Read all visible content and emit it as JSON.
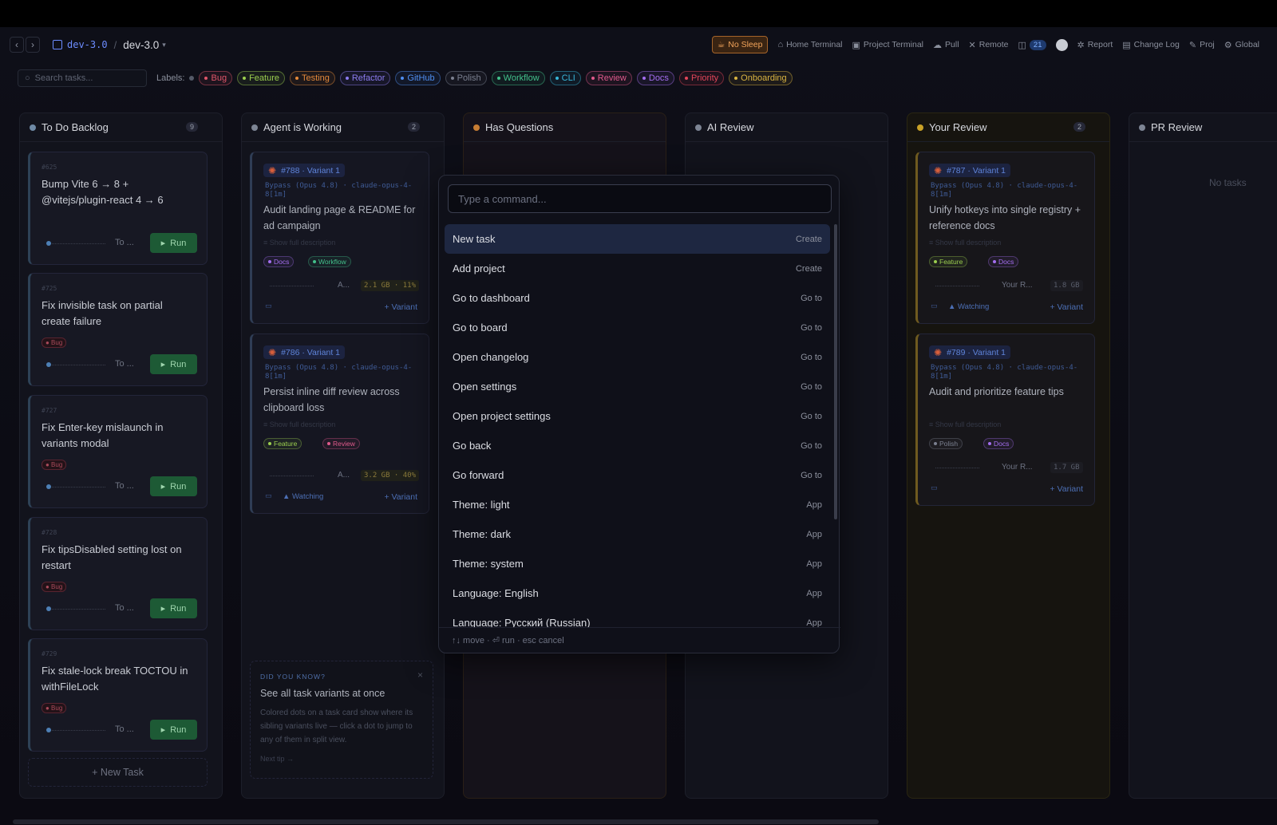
{
  "topbar": {
    "crumb_repo": "dev-3.0",
    "crumb_project": "dev-3.0",
    "no_sleep": "No Sleep",
    "home_terminal": "Home Terminal",
    "project_terminal": "Project Terminal",
    "pull": "Pull",
    "remote": "Remote",
    "count_badge": "21",
    "report": "Report",
    "change_log": "Change Log",
    "proj": "Proj",
    "global": "Global"
  },
  "labelbar": {
    "search_placeholder": "Search tasks...",
    "labels_title": "Labels:",
    "labels": [
      {
        "name": "Bug",
        "color": "#e0566a"
      },
      {
        "name": "Feature",
        "color": "#9bcf4f"
      },
      {
        "name": "Testing",
        "color": "#e4893a"
      },
      {
        "name": "Refactor",
        "color": "#8c7cf0"
      },
      {
        "name": "GitHub",
        "color": "#4f8ef0"
      },
      {
        "name": "Polish",
        "color": "#7b8090"
      },
      {
        "name": "Workflow",
        "color": "#42c08a"
      },
      {
        "name": "CLI",
        "color": "#38b6d8"
      },
      {
        "name": "Review",
        "color": "#e05a8c"
      },
      {
        "name": "Docs",
        "color": "#a46ef0"
      },
      {
        "name": "Priority",
        "color": "#e2465a"
      },
      {
        "name": "Onboarding",
        "color": "#d9b441"
      }
    ]
  },
  "columns": [
    {
      "title": "To Do Backlog",
      "count": "9",
      "color": "#6f8aa6"
    },
    {
      "title": "Agent is Working",
      "count": "2",
      "color": "#7d8594"
    },
    {
      "title": "Has Questions",
      "count": "",
      "color": "#c77d33"
    },
    {
      "title": "AI Review",
      "count": "",
      "color": "#7d8594"
    },
    {
      "title": "Your Review",
      "count": "2",
      "color": "#c9a227"
    },
    {
      "title": "PR Review",
      "count": "",
      "color": "#7d8594"
    }
  ],
  "backlog": {
    "cards": [
      {
        "num": "#625",
        "title": "Bump Vite 6 → 8 + @vitejs/plugin-react 4 → 6",
        "tag": "",
        "status": "To ...",
        "run": "Run"
      },
      {
        "num": "#725",
        "title": "Fix invisible task on partial create failure",
        "tag": "Bug",
        "status": "To ...",
        "run": "Run"
      },
      {
        "num": "#727",
        "title": "Fix Enter-key mislaunch in variants modal",
        "tag": "Bug",
        "status": "To ...",
        "run": "Run"
      },
      {
        "num": "#728",
        "title": "Fix tipsDisabled setting lost on restart",
        "tag": "Bug",
        "status": "To ...",
        "run": "Run"
      },
      {
        "num": "#729",
        "title": "Fix stale-lock break TOCTOU in withFileLock",
        "tag": "Bug",
        "status": "To ...",
        "run": "Run"
      }
    ],
    "new_task": "+ New Task"
  },
  "agent_cards": [
    {
      "id": "#788 · Variant 1",
      "bypass": "Bypass (Opus 4.8) · claude-opus-4-8[1m]",
      "title": "Audit landing page & README for ad campaign",
      "show": "Show full description",
      "tags": [
        "Docs",
        "Workflow"
      ],
      "status": "A...",
      "mem": "2.1 GB · 11%",
      "watch": "",
      "variant": "+ Variant"
    },
    {
      "id": "#786 · Variant 1",
      "bypass": "Bypass (Opus 4.8) · claude-opus-4-8[1m]",
      "title": "Persist inline diff review across clipboard loss",
      "show": "Show full description",
      "tags": [
        "Feature",
        "Review"
      ],
      "status": "A...",
      "mem": "3.2 GB · 40%",
      "watch": "Watching",
      "variant": "+ Variant"
    }
  ],
  "review_cards": [
    {
      "id": "#787 · Variant 1",
      "bypass": "Bypass (Opus 4.8) · claude-opus-4-8[1m]",
      "title": "Unify hotkeys into single registry + reference docs",
      "show": "Show full description",
      "tags": [
        "Feature",
        "Docs"
      ],
      "status": "Your R...",
      "mem": "1.8 GB",
      "watch": "Watching",
      "variant": "+ Variant"
    },
    {
      "id": "#789 · Variant 1",
      "bypass": "Bypass (Opus 4.8) · claude-opus-4-8[1m]",
      "title": "Audit and prioritize feature tips",
      "show": "Show full description",
      "tags": [
        "Polish",
        "Docs"
      ],
      "status": "Your R...",
      "mem": "1.7 GB",
      "watch": "",
      "variant": "+ Variant"
    }
  ],
  "tip": {
    "label": "DID YOU KNOW?",
    "heading": "See all task variants at once",
    "body": "Colored dots on a task card show where its sibling variants live — click a dot to jump to any of them in split view.",
    "next": "Next tip →"
  },
  "pr_review": {
    "empty": "No tasks"
  },
  "palette": {
    "placeholder": "Type a command...",
    "items": [
      {
        "label": "New task",
        "kind": "Create"
      },
      {
        "label": "Add project",
        "kind": "Create"
      },
      {
        "label": "Go to dashboard",
        "kind": "Go to"
      },
      {
        "label": "Go to board",
        "kind": "Go to"
      },
      {
        "label": "Open changelog",
        "kind": "Go to"
      },
      {
        "label": "Open settings",
        "kind": "Go to"
      },
      {
        "label": "Open project settings",
        "kind": "Go to"
      },
      {
        "label": "Go back",
        "kind": "Go to"
      },
      {
        "label": "Go forward",
        "kind": "Go to"
      },
      {
        "label": "Theme: light",
        "kind": "App"
      },
      {
        "label": "Theme: dark",
        "kind": "App"
      },
      {
        "label": "Theme: system",
        "kind": "App"
      },
      {
        "label": "Language: English",
        "kind": "App"
      },
      {
        "label": "Language: Русский (Russian)",
        "kind": "App"
      }
    ],
    "footer": "↑↓ move · ⏎ run · esc cancel"
  }
}
